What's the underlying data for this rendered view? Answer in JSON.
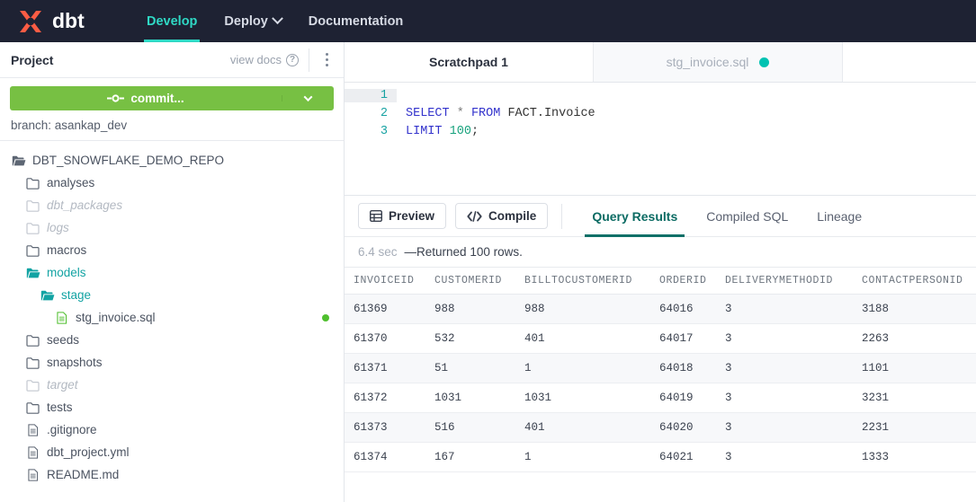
{
  "topnav": {
    "brand": "dbt",
    "brand_color": "#fc5c44",
    "accent_color": "#2fd9c5",
    "background": "#1e2233",
    "items": [
      {
        "label": "Develop",
        "active": true,
        "has_chevron": false
      },
      {
        "label": "Deploy",
        "active": false,
        "has_chevron": true
      },
      {
        "label": "Documentation",
        "active": false,
        "has_chevron": false
      }
    ]
  },
  "sidebar": {
    "title": "Project",
    "view_docs_label": "view docs",
    "help_icon": "question-circle-icon",
    "menu_icon": "kebab-menu-icon",
    "commit": {
      "label": "commit...",
      "icon": "git-commit-icon",
      "color": "#77c043",
      "dropdown_icon": "chevron-down-icon"
    },
    "branch": "branch: asankap_dev",
    "tree": [
      {
        "label": "DBT_SNOWFLAKE_DEMO_REPO",
        "type": "folder",
        "depth": 0,
        "state": "root",
        "dot": false
      },
      {
        "label": "analyses",
        "type": "folder",
        "depth": 1,
        "state": "closed",
        "dot": false
      },
      {
        "label": "dbt_packages",
        "type": "folder",
        "depth": 1,
        "state": "muted",
        "dot": false
      },
      {
        "label": "logs",
        "type": "folder",
        "depth": 1,
        "state": "muted",
        "dot": false
      },
      {
        "label": "macros",
        "type": "folder",
        "depth": 1,
        "state": "closed",
        "dot": false
      },
      {
        "label": "models",
        "type": "folder",
        "depth": 1,
        "state": "open",
        "dot": false
      },
      {
        "label": "stage",
        "type": "folder",
        "depth": 2,
        "state": "open",
        "dot": false
      },
      {
        "label": "stg_invoice.sql",
        "type": "file",
        "depth": 3,
        "state": "file",
        "dot": true
      },
      {
        "label": "seeds",
        "type": "folder",
        "depth": 1,
        "state": "closed",
        "dot": false
      },
      {
        "label": "snapshots",
        "type": "folder",
        "depth": 1,
        "state": "closed",
        "dot": false
      },
      {
        "label": "target",
        "type": "folder",
        "depth": 1,
        "state": "muted",
        "dot": false
      },
      {
        "label": "tests",
        "type": "folder",
        "depth": 1,
        "state": "closed",
        "dot": false
      },
      {
        "label": ".gitignore",
        "type": "file",
        "depth": 1,
        "state": "plain",
        "dot": false
      },
      {
        "label": "dbt_project.yml",
        "type": "file",
        "depth": 1,
        "state": "plain",
        "dot": false
      },
      {
        "label": "README.md",
        "type": "file",
        "depth": 1,
        "state": "plain",
        "dot": false
      }
    ]
  },
  "editor": {
    "tabs": [
      {
        "label": "Scratchpad 1",
        "active": true,
        "dot": false
      },
      {
        "label": "stg_invoice.sql",
        "active": false,
        "dot": true,
        "dot_color": "#00c2b2"
      }
    ],
    "lines": [
      {
        "number": "1",
        "current": true,
        "tokens": []
      },
      {
        "number": "2",
        "current": false,
        "tokens": [
          {
            "t": "SELECT",
            "c": "kw"
          },
          {
            "t": " ",
            "c": "pl"
          },
          {
            "t": "*",
            "c": "op"
          },
          {
            "t": " ",
            "c": "pl"
          },
          {
            "t": "FROM",
            "c": "kw"
          },
          {
            "t": " FACT.Invoice",
            "c": "pl"
          }
        ]
      },
      {
        "number": "3",
        "current": false,
        "tokens": [
          {
            "t": "LIMIT",
            "c": "kw"
          },
          {
            "t": " ",
            "c": "pl"
          },
          {
            "t": "100",
            "c": "num"
          },
          {
            "t": ";",
            "c": "pl"
          }
        ]
      }
    ]
  },
  "toolbar": {
    "preview_label": "Preview",
    "preview_icon": "table-grid-icon",
    "compile_label": "Compile",
    "compile_icon": "code-brackets-icon",
    "result_tabs": [
      {
        "label": "Query Results",
        "active": true
      },
      {
        "label": "Compiled SQL",
        "active": false
      },
      {
        "label": "Lineage",
        "active": false
      }
    ],
    "active_underline_color": "#0f7068"
  },
  "status": {
    "duration": "6.4 sec",
    "message": "—Returned 100 rows."
  },
  "results_table": {
    "columns": [
      "INVOICEID",
      "CUSTOMERID",
      "BILLTOCUSTOMERID",
      "ORDERID",
      "DELIVERYMETHODID",
      "CONTACTPERSONID"
    ],
    "rows": [
      [
        "61369",
        "988",
        "988",
        "64016",
        "3",
        "3188"
      ],
      [
        "61370",
        "532",
        "401",
        "64017",
        "3",
        "2263"
      ],
      [
        "61371",
        "51",
        "1",
        "64018",
        "3",
        "1101"
      ],
      [
        "61372",
        "1031",
        "1031",
        "64019",
        "3",
        "3231"
      ],
      [
        "61373",
        "516",
        "401",
        "64020",
        "3",
        "2231"
      ],
      [
        "61374",
        "167",
        "1",
        "64021",
        "3",
        "1333"
      ]
    ]
  }
}
